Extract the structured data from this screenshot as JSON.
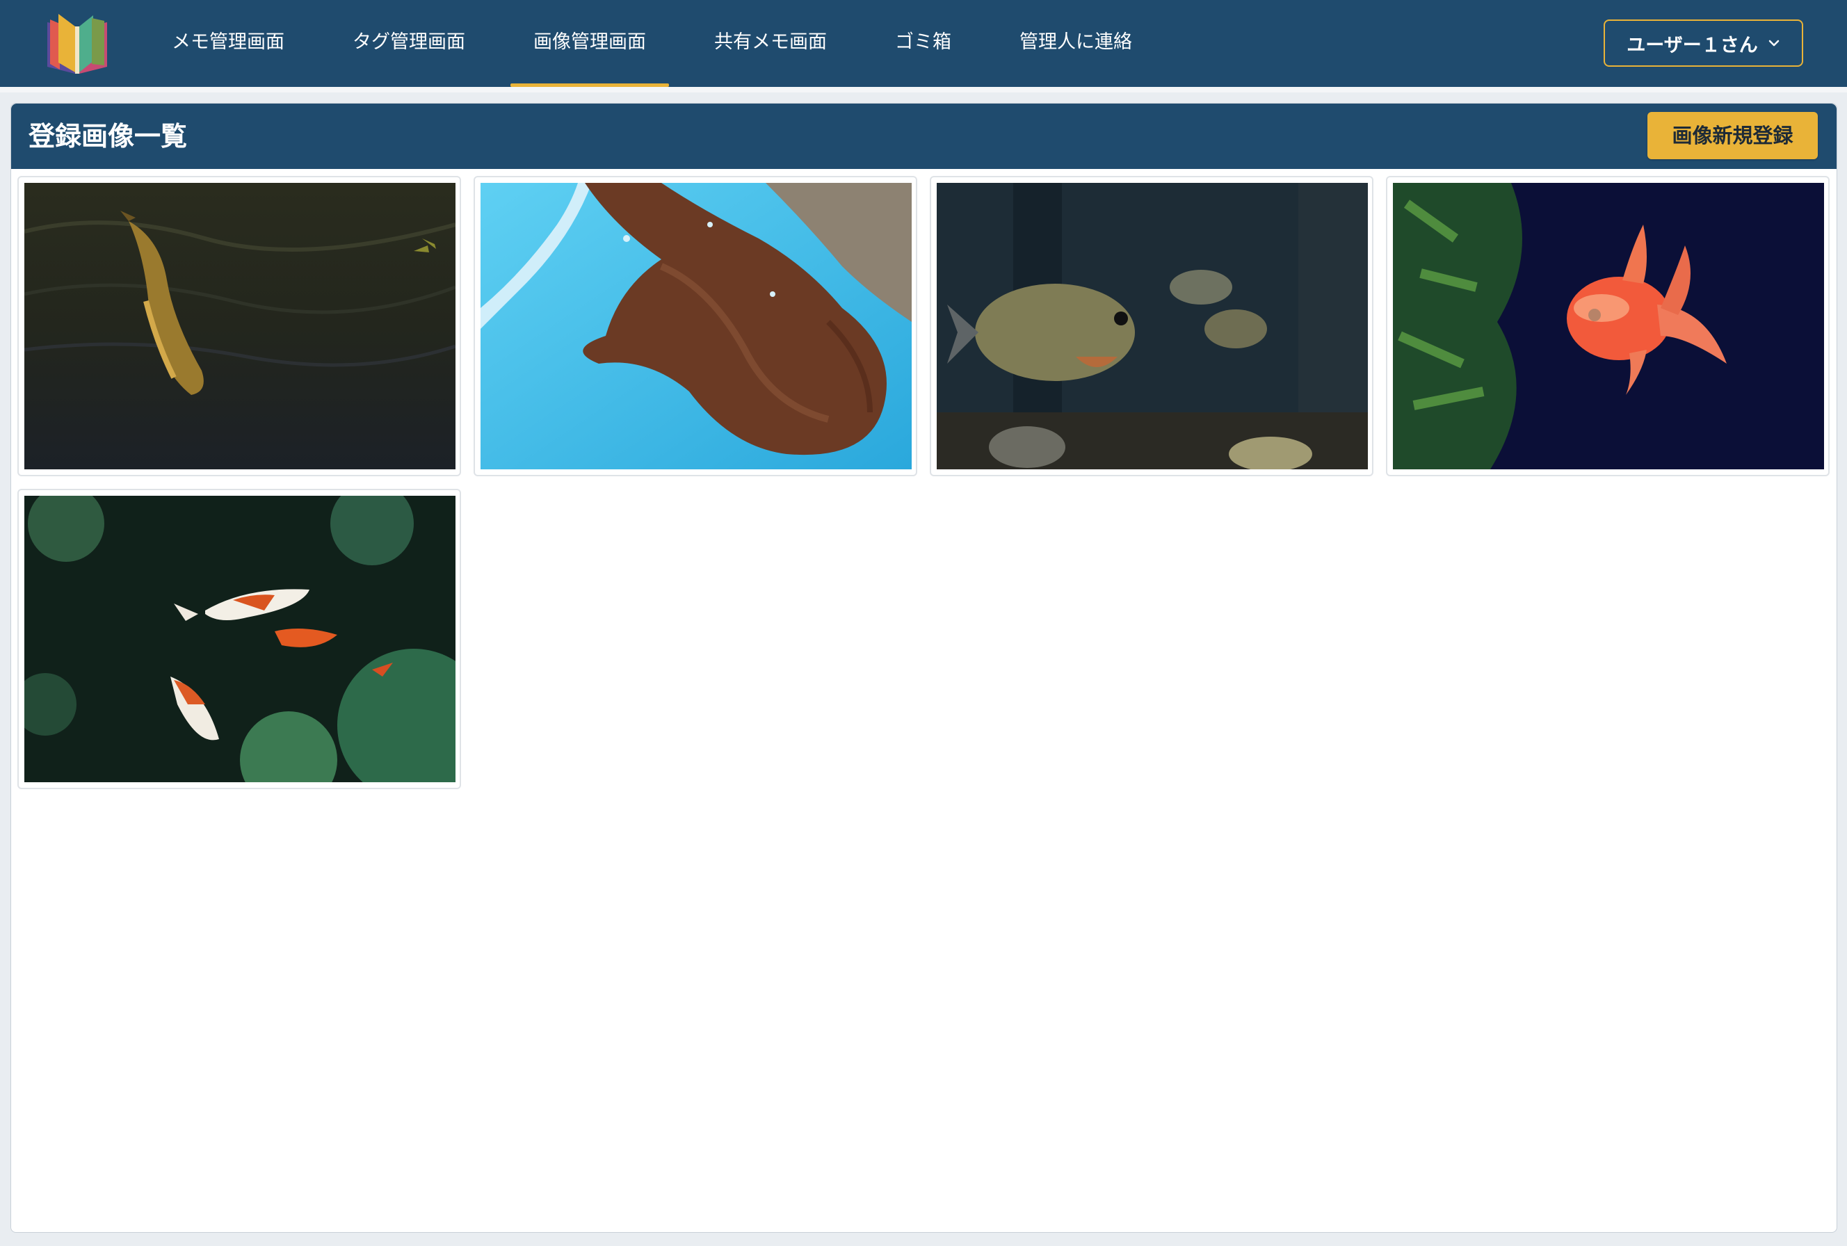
{
  "nav": {
    "items": [
      {
        "label": "メモ管理画面"
      },
      {
        "label": "タグ管理画面"
      },
      {
        "label": "画像管理画面"
      },
      {
        "label": "共有メモ画面"
      },
      {
        "label": "ゴミ箱"
      },
      {
        "label": "管理人に連絡"
      }
    ],
    "active_index": 2,
    "user_label": "ユーザー１さん",
    "user_icon": "chevron-down-icon"
  },
  "panel": {
    "title": "登録画像一覧",
    "new_button_label": "画像新規登録"
  },
  "images": [
    {
      "subject": "koi-in-dark-pond"
    },
    {
      "subject": "anglerfish-in-blue-tub"
    },
    {
      "subject": "piranha-aquarium"
    },
    {
      "subject": "red-goldfish"
    },
    {
      "subject": "kohaku-koi-group"
    }
  ],
  "colors": {
    "navbar": "#1f4b6e",
    "accent": "#e9b338",
    "text_on_dark": "#ffffff"
  }
}
